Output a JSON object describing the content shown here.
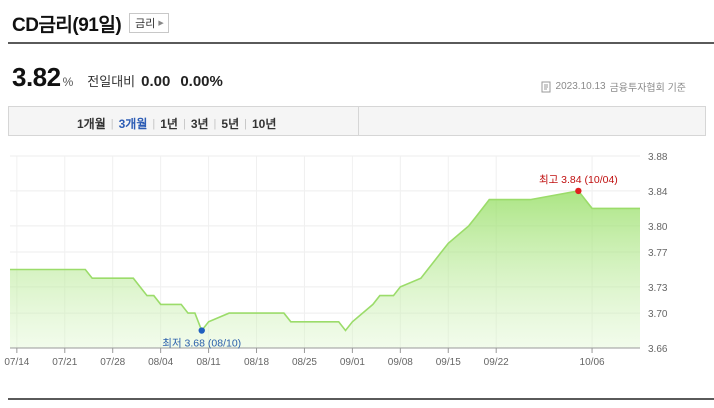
{
  "header": {
    "title": "CD금리(91일)",
    "tag_label": "금리"
  },
  "quote": {
    "value": "3.82",
    "unit": "%",
    "change_label": "전일대비",
    "change": "0.00",
    "change_percent": "0.00%"
  },
  "source": {
    "date": "2023.10.13",
    "provider": "금융투자협회 기준",
    "icon": "document-icon"
  },
  "tabs": [
    {
      "label": "1개월",
      "active": false
    },
    {
      "label": "3개월",
      "active": true
    },
    {
      "label": "1년",
      "active": false
    },
    {
      "label": "3년",
      "active": false
    },
    {
      "label": "5년",
      "active": false
    },
    {
      "label": "10년",
      "active": false
    }
  ],
  "chart_data": {
    "type": "area",
    "x": [
      "2023-07-13",
      "2023-07-14",
      "2023-07-17",
      "2023-07-18",
      "2023-07-19",
      "2023-07-20",
      "2023-07-21",
      "2023-07-24",
      "2023-07-25",
      "2023-07-26",
      "2023-07-27",
      "2023-07-28",
      "2023-07-31",
      "2023-08-01",
      "2023-08-02",
      "2023-08-03",
      "2023-08-04",
      "2023-08-07",
      "2023-08-08",
      "2023-08-09",
      "2023-08-10",
      "2023-08-11",
      "2023-08-14",
      "2023-08-16",
      "2023-08-17",
      "2023-08-18",
      "2023-08-21",
      "2023-08-22",
      "2023-08-23",
      "2023-08-24",
      "2023-08-25",
      "2023-08-28",
      "2023-08-29",
      "2023-08-30",
      "2023-08-31",
      "2023-09-01",
      "2023-09-04",
      "2023-09-05",
      "2023-09-06",
      "2023-09-07",
      "2023-09-08",
      "2023-09-11",
      "2023-09-12",
      "2023-09-13",
      "2023-09-14",
      "2023-09-15",
      "2023-09-18",
      "2023-09-19",
      "2023-09-20",
      "2023-09-21",
      "2023-09-22",
      "2023-09-25",
      "2023-09-26",
      "2023-09-27",
      "2023-10-04",
      "2023-10-05",
      "2023-10-06",
      "2023-10-10",
      "2023-10-11",
      "2023-10-12",
      "2023-10-13"
    ],
    "values": [
      3.75,
      3.75,
      3.75,
      3.75,
      3.75,
      3.75,
      3.75,
      3.75,
      3.74,
      3.74,
      3.74,
      3.74,
      3.74,
      3.73,
      3.72,
      3.72,
      3.71,
      3.71,
      3.7,
      3.7,
      3.68,
      3.69,
      3.7,
      3.7,
      3.7,
      3.7,
      3.7,
      3.7,
      3.69,
      3.69,
      3.69,
      3.69,
      3.69,
      3.69,
      3.68,
      3.69,
      3.71,
      3.72,
      3.72,
      3.72,
      3.73,
      3.74,
      3.75,
      3.76,
      3.77,
      3.78,
      3.8,
      3.81,
      3.82,
      3.83,
      3.83,
      3.83,
      3.83,
      3.83,
      3.84,
      3.83,
      3.82,
      3.82,
      3.82,
      3.82,
      3.82
    ],
    "x_ticks": [
      "07/14",
      "07/21",
      "07/28",
      "08/04",
      "08/11",
      "08/18",
      "08/25",
      "09/01",
      "09/08",
      "09/15",
      "09/22",
      "10/06"
    ],
    "y_ticks": [
      "3.88",
      "3.84",
      "3.80",
      "3.77",
      "3.73",
      "3.70",
      "3.66"
    ],
    "ylim": [
      3.66,
      3.88
    ],
    "grid": true,
    "axis_position": "right",
    "color": "#8fdc5a",
    "max": {
      "label": "최고 3.84 (10/04)",
      "date": "2023-10-04",
      "value": 3.84,
      "color": "#e02020"
    },
    "min": {
      "label": "최저 3.68 (08/10)",
      "date": "2023-08-10",
      "value": 3.68,
      "color": "#2060c0"
    }
  }
}
